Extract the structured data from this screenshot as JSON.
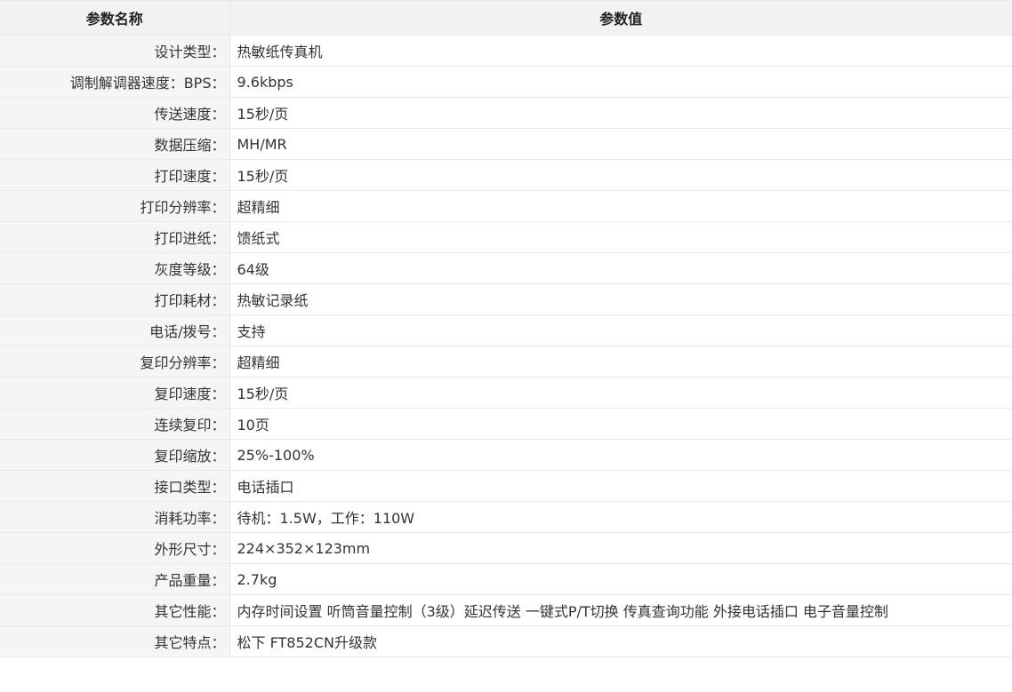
{
  "table": {
    "headers": {
      "name": "参数名称",
      "value": "参数值"
    },
    "rows": [
      {
        "name": "设计类型：",
        "value": "热敏纸传真机"
      },
      {
        "name": "调制解调器速度：BPS：",
        "value": "9.6kbps"
      },
      {
        "name": "传送速度：",
        "value": "15秒/页"
      },
      {
        "name": "数据压缩：",
        "value": "MH/MR"
      },
      {
        "name": "打印速度：",
        "value": "15秒/页"
      },
      {
        "name": "打印分辨率：",
        "value": "超精细"
      },
      {
        "name": "打印进纸：",
        "value": "馈纸式"
      },
      {
        "name": "灰度等级：",
        "value": "64级"
      },
      {
        "name": "打印耗材：",
        "value": "热敏记录纸"
      },
      {
        "name": "电话/拨号：",
        "value": "支持"
      },
      {
        "name": "复印分辨率：",
        "value": "超精细"
      },
      {
        "name": "复印速度：",
        "value": "15秒/页"
      },
      {
        "name": "连续复印：",
        "value": "10页"
      },
      {
        "name": "复印缩放：",
        "value": "25%-100%"
      },
      {
        "name": "接口类型：",
        "value": "电话插口"
      },
      {
        "name": "消耗功率：",
        "value": "待机：1.5W，工作：110W"
      },
      {
        "name": "外形尺寸：",
        "value": "224×352×123mm"
      },
      {
        "name": "产品重量：",
        "value": "2.7kg"
      },
      {
        "name": "其它性能：",
        "value": "内存时间设置 听筒音量控制（3级）延迟传送 一键式P/T切换 传真查询功能 外接电话插口 电子音量控制"
      },
      {
        "name": "其它特点：",
        "value": "松下 FT852CN升级款"
      }
    ]
  }
}
